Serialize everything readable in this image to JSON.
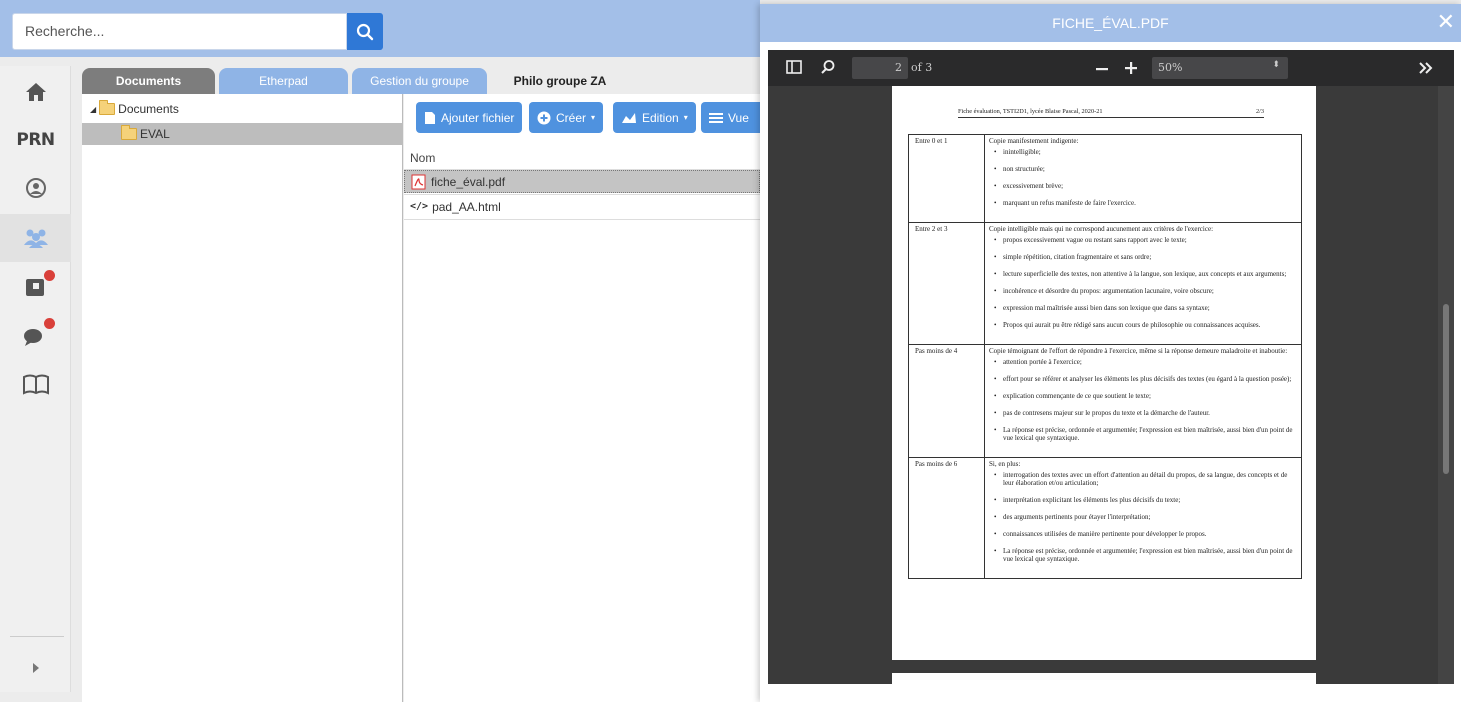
{
  "search": {
    "placeholder": "Recherche..."
  },
  "rail": {
    "prn_label": "PRN"
  },
  "tabs": [
    {
      "label": "Documents"
    },
    {
      "label": "Etherpad"
    },
    {
      "label": "Gestion du groupe"
    },
    {
      "label": "Philo groupe ZA"
    }
  ],
  "tree": {
    "root": "Documents",
    "child": "EVAL"
  },
  "toolbar": {
    "add_file": "Ajouter fichier",
    "create": "Créer",
    "edit": "Edition",
    "view": "Vue"
  },
  "files": {
    "column_name": "Nom",
    "rows": [
      "fiche_éval.pdf",
      "pad_AA.html"
    ]
  },
  "modal": {
    "title": "FICHE_ÉVAL.PDF",
    "page_number": "2",
    "page_of": "of 3",
    "zoom": "50%"
  },
  "document": {
    "running_head": "Fiche évaluation, TSTI2D1, lycée Blaise Pascal, 2020-21",
    "page_label": "2/3",
    "rows": [
      {
        "range": "Entre 0 et 1",
        "intro": "Copie manifestement indigente:",
        "items": [
          "inintelligible;",
          "non structurée;",
          "excessivement brève;",
          "marquant un refus manifeste de faire l'exercice."
        ]
      },
      {
        "range": "Entre 2 et 3",
        "intro": "Copie intelligible mais qui ne correspond aucunement aux critères de l'exercice:",
        "items": [
          "propos excessivement vague ou restant sans rapport avec le texte;",
          "simple répétition, citation fragmentaire et sans ordre;",
          "lecture superficielle des textes, non attentive à la langue, son lexique, aux concepts et aux arguments;",
          "incohérence et désordre du propos: argumentation lacunaire, voire obscure;",
          "expression mal maîtrisée aussi bien dans son lexique que dans sa syntaxe;",
          "Propos qui aurait pu être rédigé sans aucun cours de philosophie ou connaissances acquises."
        ]
      },
      {
        "range": "Pas moins de 4",
        "intro": "Copie témoignant de l'effort de répondre à l'exercice, même si la réponse demeure maladroite et inaboutie:",
        "items": [
          "attention portée à l'exercice;",
          "effort pour se référer et analyser les éléments les plus décisifs des textes (eu égard à la question posée);",
          "explication commençante de ce que soutient le texte;",
          "pas de contresens majeur sur le propos du texte et la démarche de l'auteur.",
          "La réponse est précise, ordonnée et argumentée; l'expression est bien maîtrisée, aussi bien d'un point de vue lexical que syntaxique."
        ]
      },
      {
        "range": "Pas moins de 6",
        "intro": "Si, en plus:",
        "items": [
          "interrogation des textes avec un effort d'attention au détail du propos, de sa langue, des concepts et de leur élaboration et/ou articulation;",
          "interprétation explicitant les éléments les plus décisifs du texte;",
          "des arguments pertinents pour étayer l'interprétation;",
          "connaissances utilisées de manière pertinente pour développer le propos.",
          "La réponse est précise, ordonnée et argumentée; l'expression est bien maîtrisée, aussi bien d'un point de vue lexical que syntaxique."
        ]
      }
    ]
  }
}
